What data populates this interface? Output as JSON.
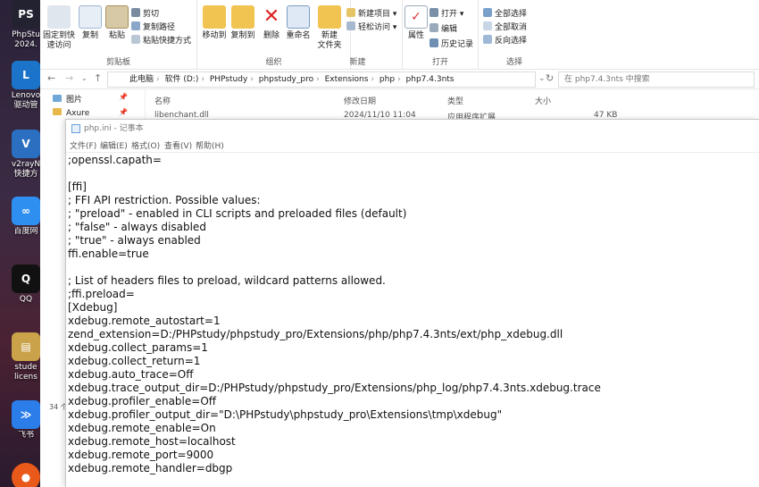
{
  "desktop": {
    "icons": [
      {
        "label": "PhpStu\n2024.",
        "glyph": "PS",
        "color": "#222230"
      },
      {
        "label": "Lenovo\n驱动管",
        "glyph": "L",
        "color": "#1b74c9"
      },
      {
        "label": "v2rayN\n快捷方",
        "glyph": "V",
        "color": "#2a6fc0"
      },
      {
        "label": "百度网",
        "glyph": "∞",
        "color": "#2f8ff0"
      },
      {
        "label": "QQ",
        "glyph": "Q",
        "color": "#111"
      },
      {
        "label": "stude\nlicens",
        "glyph": "▤",
        "color": "#c9a24a"
      },
      {
        "label": "飞书",
        "glyph": "≫",
        "color": "#2b7de9"
      },
      {
        "label": "",
        "glyph": "●",
        "color": "#e8591a"
      }
    ],
    "side_texts": [
      "o",
      "ay",
      "nt"
    ]
  },
  "ribbon": {
    "clipboard": {
      "pin_label": "固定到快\n速访问",
      "copy_label": "复制",
      "paste_label": "粘贴",
      "cut_label": "剪切",
      "copy_path_label": "复制路径",
      "paste_shortcut_label": "粘贴快捷方式",
      "group_label": "剪贴板"
    },
    "organize": {
      "move_to_label": "移动到",
      "copy_to_label": "复制到",
      "delete_label": "删除",
      "rename_label": "重命名",
      "group_label": "组织"
    },
    "new": {
      "new_folder_label": "新建\n文件夹",
      "new_item_label": "新建项目 ▾",
      "easy_access_label": "轻松访问 ▾",
      "group_label": "新建"
    },
    "open": {
      "properties_label": "属性",
      "open_label": "打开 ▾",
      "edit_label": "编辑",
      "history_label": "历史记录",
      "group_label": "打开"
    },
    "select": {
      "select_all_label": "全部选择",
      "select_none_label": "全部取消",
      "invert_label": "反向选择",
      "group_label": "选择"
    }
  },
  "addressbar": {
    "crumbs": [
      "此电脑",
      "软件 (D:)",
      "PHPstudy",
      "phpstudy_pro",
      "Extensions",
      "php",
      "php7.4.3nts"
    ],
    "search_placeholder": "在 php7.4.3nts 中搜索"
  },
  "navpane": {
    "items": [
      "图片",
      "Axure"
    ]
  },
  "columns": {
    "name": "名称",
    "modified": "修改日期",
    "type": "类型",
    "size": "大小"
  },
  "file_row": {
    "name": "libenchant.dll",
    "modified": "2024/11/10 11:04",
    "type": "应用程序扩展",
    "size": "47 KB"
  },
  "status": {
    "count": "34 个"
  },
  "notepad": {
    "title": "php.ini - 记事本",
    "menu": [
      "文件(F)",
      "编辑(E)",
      "格式(O)",
      "查看(V)",
      "帮助(H)"
    ],
    "lines": [
      ";openssl.capath=",
      "",
      "[ffi]",
      "; FFI API restriction. Possible values:",
      "; \"preload\" - enabled in CLI scripts and preloaded files (default)",
      "; \"false\"   - always disabled",
      "; \"true\"    - always enabled",
      "ffi.enable=true",
      "",
      "; List of headers files to preload, wildcard patterns allowed.",
      ";ffi.preload=",
      "[Xdebug]",
      "xdebug.remote_autostart=1",
      "zend_extension=D:/PHPstudy/phpstudy_pro/Extensions/php/php7.4.3nts/ext/php_xdebug.dll",
      "xdebug.collect_params=1",
      "xdebug.collect_return=1",
      "xdebug.auto_trace=Off",
      "xdebug.trace_output_dir=D:/PHPstudy/phpstudy_pro/Extensions/php_log/php7.4.3nts.xdebug.trace",
      "xdebug.profiler_enable=Off",
      "xdebug.profiler_output_dir=\"D:\\PHPstudy\\phpstudy_pro\\Extensions\\tmp\\xdebug\"",
      "xdebug.remote_enable=On",
      "xdebug.remote_host=localhost",
      "xdebug.remote_port=9000",
      "xdebug.remote_handler=dbgp"
    ]
  }
}
